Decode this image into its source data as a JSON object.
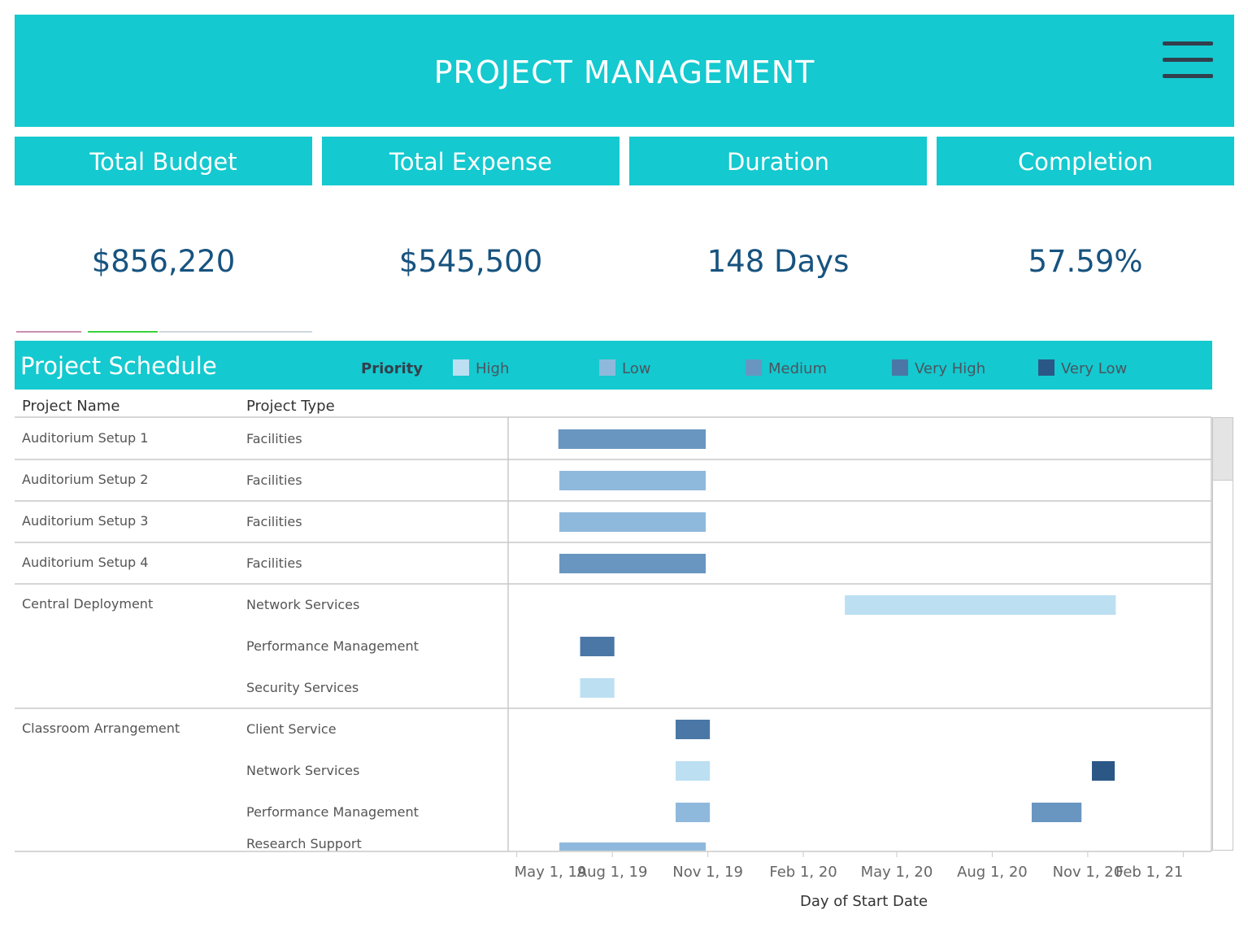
{
  "header": {
    "title": "PROJECT MANAGEMENT"
  },
  "kpis": [
    {
      "label": "Total Budget",
      "value": "$856,220"
    },
    {
      "label": "Total Expense",
      "value": "$545,500"
    },
    {
      "label": "Duration",
      "value": "148 Days"
    },
    {
      "label": "Completion",
      "value": "57.59%"
    }
  ],
  "schedule": {
    "title": "Project Schedule",
    "priority_label": "Priority",
    "col_project_name": "Project Name",
    "col_project_type": "Project Type"
  },
  "chart_data": {
    "type": "gantt",
    "xlabel": "Day of Start Date",
    "x_ticks": [
      "May 1, 19",
      "Aug 1, 19",
      "Nov 1, 19",
      "Feb 1, 20",
      "May 1, 20",
      "Aug 1, 20",
      "Nov 1, 20",
      "Feb 1, 21"
    ],
    "xlim": [
      "2019-04-25",
      "2021-02-25"
    ],
    "legend": {
      "title": "Priority",
      "placement": "top",
      "items": [
        {
          "name": "High",
          "color": "#bcdff2"
        },
        {
          "name": "Low",
          "color": "#8fb9dc"
        },
        {
          "name": "Medium",
          "color": "#6996c1"
        },
        {
          "name": "Very High",
          "color": "#4a77a6"
        },
        {
          "name": "Very Low",
          "color": "#2b5787"
        }
      ]
    },
    "rows": [
      {
        "project": "Auditorium Setup 1",
        "type": "Facilities",
        "tasks": [
          {
            "start": "2019-06-10",
            "end": "2019-10-30",
            "priority": "Medium"
          }
        ]
      },
      {
        "project": "Auditorium Setup 2",
        "type": "Facilities",
        "tasks": [
          {
            "start": "2019-06-11",
            "end": "2019-10-30",
            "priority": "Low"
          }
        ]
      },
      {
        "project": "Auditorium Setup 3",
        "type": "Facilities",
        "tasks": [
          {
            "start": "2019-06-11",
            "end": "2019-10-30",
            "priority": "Low"
          }
        ]
      },
      {
        "project": "Auditorium Setup 4",
        "type": "Facilities",
        "tasks": [
          {
            "start": "2019-06-11",
            "end": "2019-10-30",
            "priority": "Medium"
          }
        ]
      },
      {
        "project": "Central Deployment",
        "type": "Network Services",
        "tasks": [
          {
            "start": "2020-03-12",
            "end": "2020-11-28",
            "priority": "High"
          }
        ]
      },
      {
        "project": "",
        "type": "Performance Management",
        "tasks": [
          {
            "start": "2019-07-01",
            "end": "2019-08-03",
            "priority": "Very High"
          }
        ]
      },
      {
        "project": "",
        "type": "Security Services",
        "tasks": [
          {
            "start": "2019-07-01",
            "end": "2019-08-03",
            "priority": "High"
          }
        ]
      },
      {
        "project": "Classroom Arrangement",
        "type": "Client Service",
        "tasks": [
          {
            "start": "2019-10-01",
            "end": "2019-11-03",
            "priority": "Very High"
          }
        ]
      },
      {
        "project": "",
        "type": "Network Services",
        "tasks": [
          {
            "start": "2019-10-01",
            "end": "2019-11-03",
            "priority": "High"
          },
          {
            "start": "2020-11-05",
            "end": "2020-11-27",
            "priority": "Very Low"
          }
        ]
      },
      {
        "project": "",
        "type": "Performance Management",
        "tasks": [
          {
            "start": "2019-10-01",
            "end": "2019-11-03",
            "priority": "Low"
          },
          {
            "start": "2020-09-08",
            "end": "2020-10-26",
            "priority": "Medium"
          }
        ]
      },
      {
        "project": "",
        "type": "Research Support",
        "tasks": [
          {
            "start": "2019-06-11",
            "end": "2019-10-30",
            "priority": "Low"
          }
        ]
      }
    ]
  }
}
